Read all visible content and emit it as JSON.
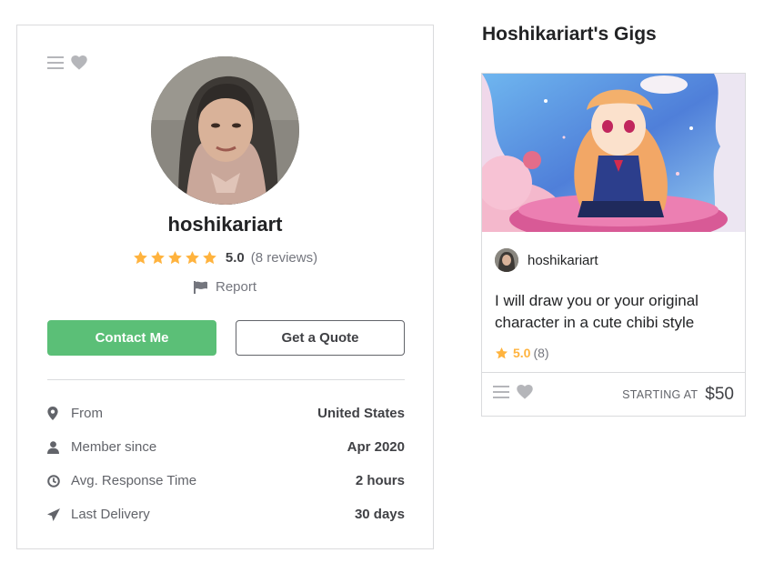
{
  "profile": {
    "username": "hoshikariart",
    "rating": {
      "stars": 5,
      "score": "5.0",
      "reviews": "(8 reviews)"
    },
    "report_label": "Report",
    "contact_button": "Contact Me",
    "quote_button": "Get a Quote",
    "stats": [
      {
        "icon": "location-pin-icon",
        "label": "From",
        "value": "United States"
      },
      {
        "icon": "user-icon",
        "label": "Member since",
        "value": "Apr 2020"
      },
      {
        "icon": "clock-icon",
        "label": "Avg. Response Time",
        "value": "2 hours"
      },
      {
        "icon": "paper-plane-icon",
        "label": "Last Delivery",
        "value": "30 days"
      }
    ]
  },
  "gigs": {
    "title": "Hoshikariart's Gigs",
    "items": [
      {
        "seller": "hoshikariart",
        "description": "I will draw you or your original character in a cute chibi style",
        "rating_score": "5.0",
        "rating_count": "(8)",
        "starting_label": "STARTING AT",
        "price": "$50"
      }
    ]
  },
  "colors": {
    "accent_green": "#5bbf77",
    "star_yellow": "#ffb33e",
    "text_dark": "#222325",
    "border": "#dadbdd"
  }
}
